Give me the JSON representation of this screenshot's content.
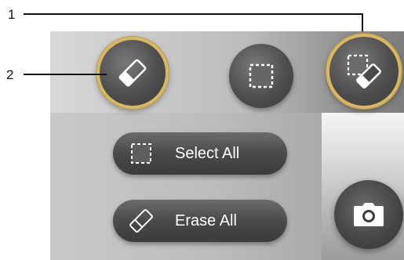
{
  "callouts": [
    {
      "number": "1"
    },
    {
      "number": "2"
    }
  ],
  "toolbar": {
    "tools": [
      {
        "name": "eraser",
        "icon": "eraser-icon",
        "active": true
      },
      {
        "name": "select",
        "icon": "dashed-square-select-icon",
        "active": false
      },
      {
        "name": "select-erase",
        "icon": "select-eraser-icon",
        "active": true
      }
    ],
    "accent_color": "#d8b760"
  },
  "actions": {
    "select_all_label": "Select All",
    "select_all_icon": "dashed-square-icon",
    "erase_all_label": "Erase All",
    "erase_all_icon": "eraser-outline-icon"
  },
  "camera": {
    "icon": "camera-icon"
  }
}
